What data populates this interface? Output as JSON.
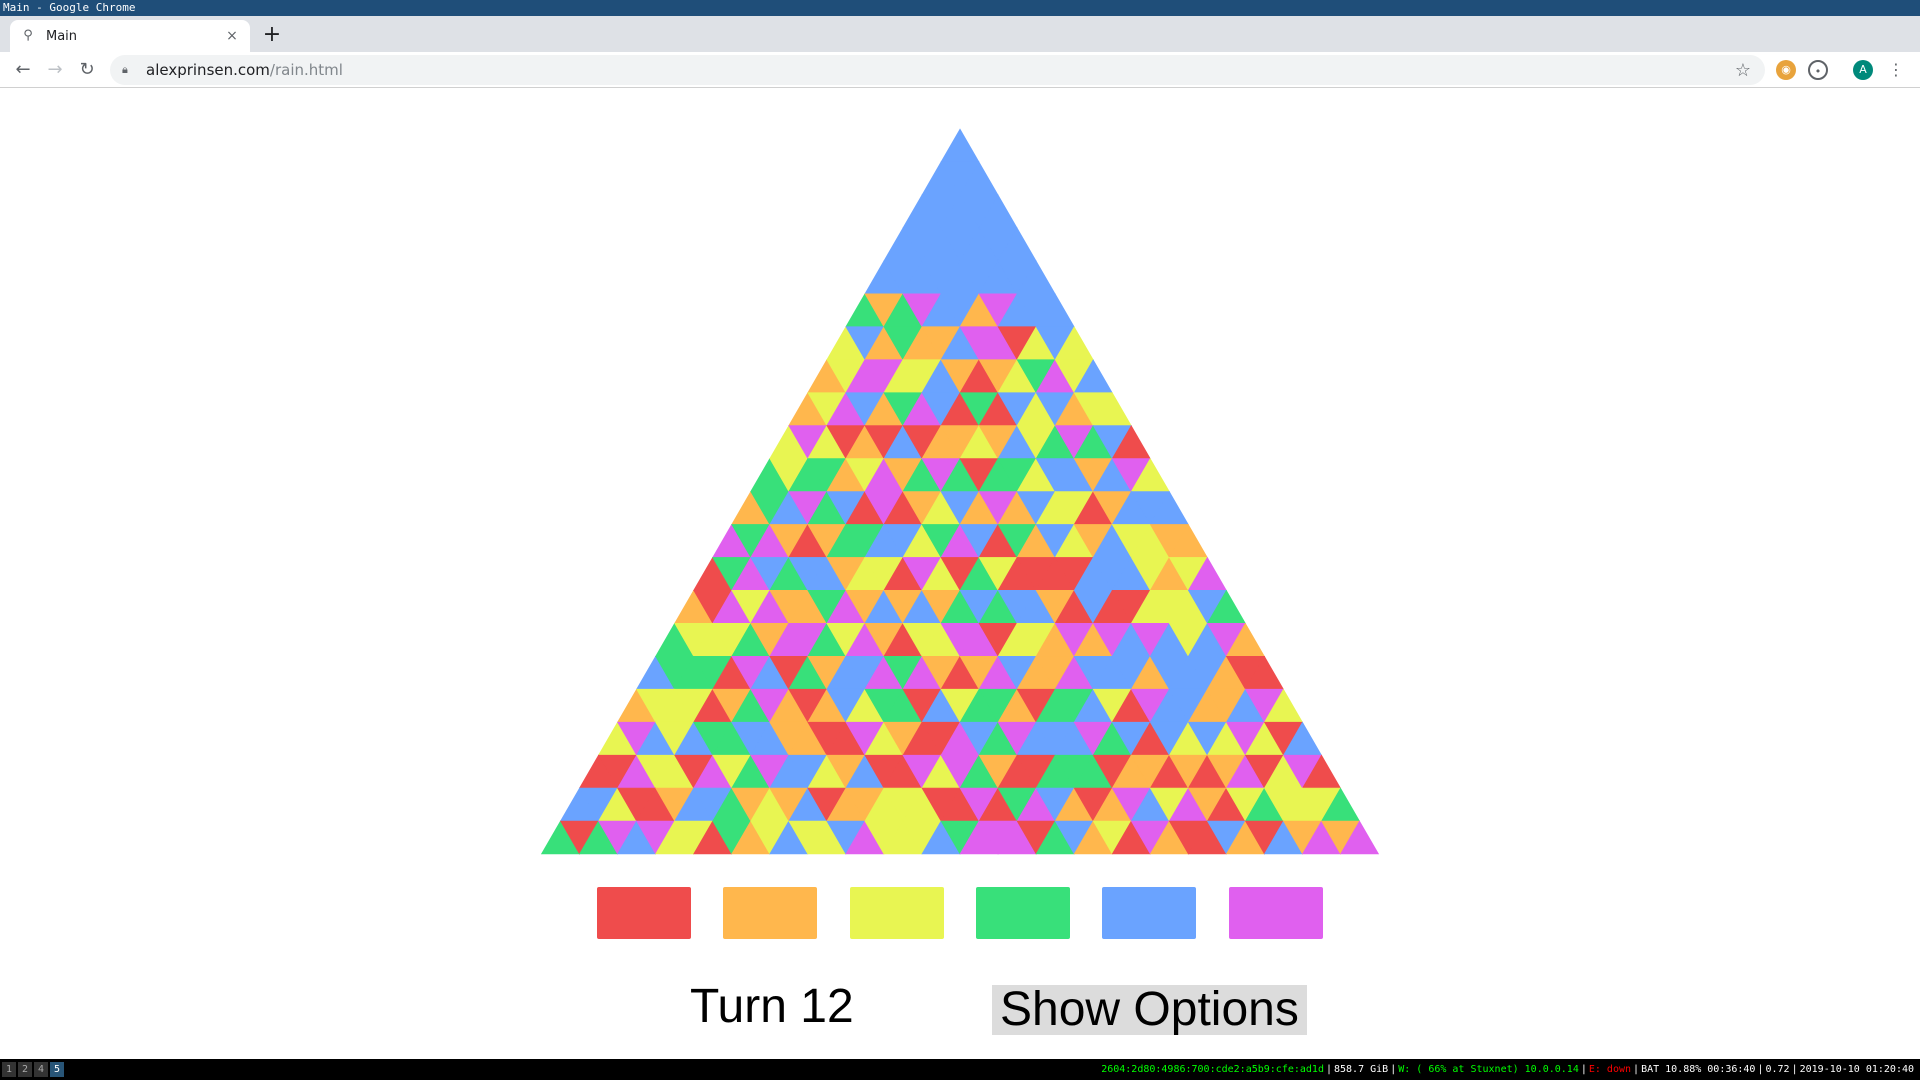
{
  "window": {
    "title": "Main - Google Chrome"
  },
  "tab": {
    "title": "Main",
    "close": "×",
    "new_tab": "+"
  },
  "toolbar": {
    "back": "←",
    "forward": "→",
    "reload": "↻",
    "url_host": "alexprinsen.com",
    "url_path": "/rain.html",
    "star": "☆",
    "avatar": "A",
    "menu": "⋮"
  },
  "game": {
    "turn_label": "Turn 12",
    "options_button": "Show Options",
    "palette": [
      {
        "name": "red",
        "color": "#ef4c4c"
      },
      {
        "name": "orange",
        "color": "#ffb74d"
      },
      {
        "name": "yellow",
        "color": "#e8f552"
      },
      {
        "name": "green",
        "color": "#38e07a"
      },
      {
        "name": "blue",
        "color": "#6aa3ff"
      },
      {
        "name": "magenta",
        "color": "#e060ef"
      }
    ],
    "rows": 22,
    "flooded_rows": 5,
    "flooded_color": "#6aa3ff"
  },
  "statusbar": {
    "workspaces": [
      "1",
      "2",
      "4",
      "5"
    ],
    "active_workspace": "5",
    "ipv6": "2604:2d80:4986:700:cde2:a5b9:cfe:ad1d",
    "disk": "858.7 GiB",
    "wifi": "W: ( 66% at Stuxnet) 10.0.0.14",
    "ethernet": "E: down",
    "battery": "BAT 10.88% 00:36:40",
    "load": "0.72",
    "datetime": "2019-10-10 01:20:40"
  }
}
